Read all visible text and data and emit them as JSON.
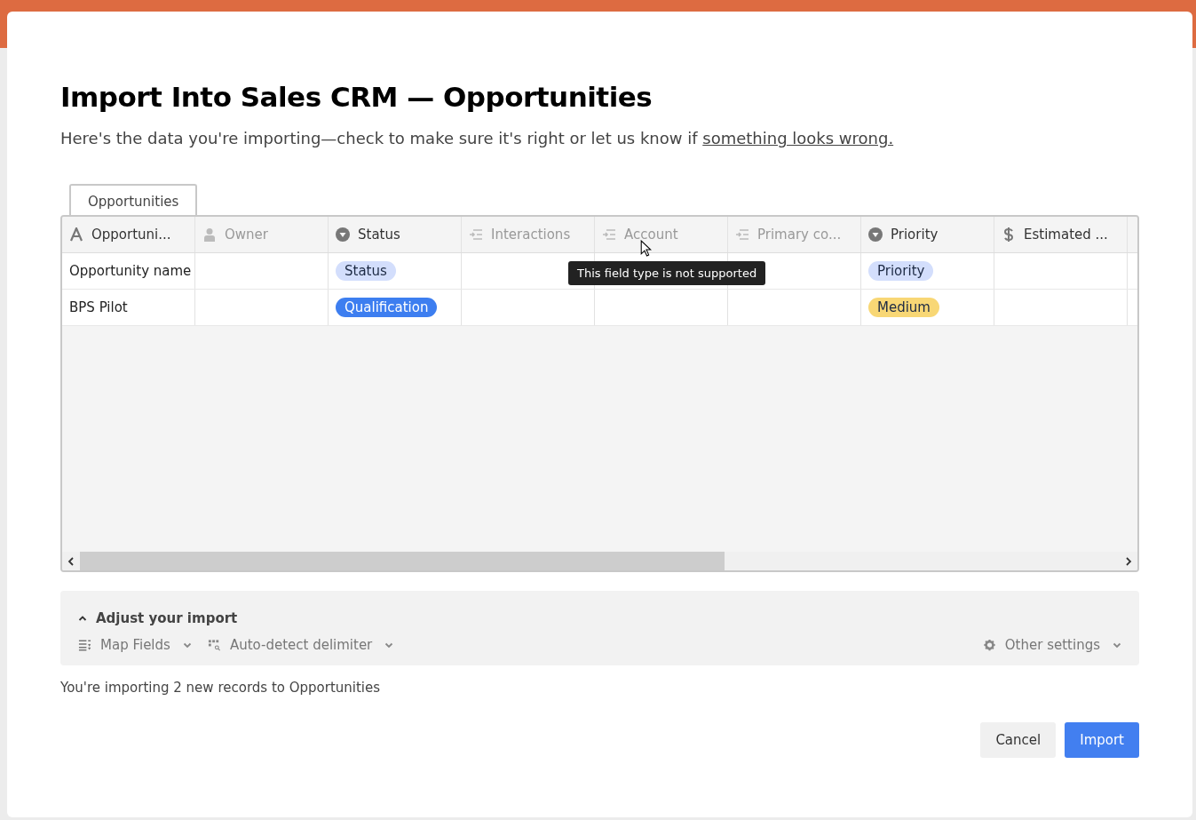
{
  "dialog": {
    "title": "Import Into Sales CRM — Opportunities",
    "subtitle": "Here's the data you're importing—check to make sure it's right or let us know if",
    "subtitle_link": "something looks wrong."
  },
  "tabs": [
    {
      "label": "Opportunities",
      "selected": true
    }
  ],
  "table": {
    "columns": [
      {
        "label": "Opportuni...",
        "kind": "text",
        "disabled": false
      },
      {
        "label": "Owner",
        "kind": "user",
        "disabled": true
      },
      {
        "label": "Status",
        "kind": "select",
        "disabled": false
      },
      {
        "label": "Interactions",
        "kind": "link",
        "disabled": true
      },
      {
        "label": "Account",
        "kind": "link",
        "disabled": true
      },
      {
        "label": "Primary co...",
        "kind": "link",
        "disabled": true
      },
      {
        "label": "Priority",
        "kind": "select",
        "disabled": false
      },
      {
        "label": "Estimated ...",
        "kind": "currency",
        "disabled": false
      }
    ],
    "rows": [
      {
        "cells": [
          {
            "text": "Opportunity name"
          },
          {},
          {
            "tag": "Status",
            "color": "#d3defc"
          },
          {},
          {},
          {},
          {
            "tag": "Priority",
            "color": "#d3defc"
          },
          {}
        ]
      },
      {
        "cells": [
          {
            "text": "BPS Pilot"
          },
          {},
          {
            "tag": "Qualification",
            "color": "#3d7ef0"
          },
          {},
          {},
          {},
          {
            "tag": "Medium",
            "color": "#f8d775"
          },
          {}
        ]
      }
    ],
    "tooltip": "This field type is not supported"
  },
  "adjust": {
    "title": "Adjust your import",
    "expanded": true,
    "options": [
      {
        "label": "Map Fields",
        "kind": "map"
      },
      {
        "label": "Auto-detect delimiter",
        "kind": "delimiter"
      }
    ],
    "other": "Other settings"
  },
  "summary": "You're importing 2 new records to Opportunities",
  "buttons": [
    {
      "label": "Cancel",
      "kind": "secondary"
    },
    {
      "label": "Import",
      "kind": "primary"
    }
  ]
}
